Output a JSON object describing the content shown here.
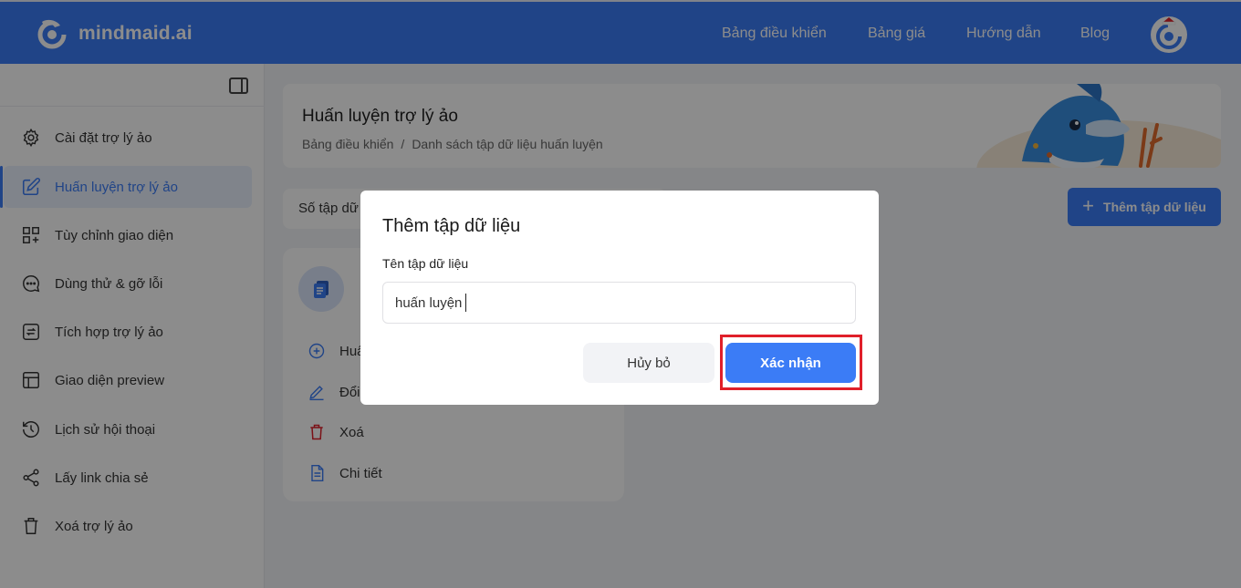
{
  "app": {
    "brand": "mindmaid.ai",
    "accent_color": "#3b7cf6"
  },
  "nav": {
    "links": [
      "Bảng điều khiển",
      "Bảng giá",
      "Hướng dẫn",
      "Blog"
    ]
  },
  "sidebar": {
    "items": [
      {
        "label": "Cài đặt trợ lý ảo",
        "icon": "gear-icon"
      },
      {
        "label": "Huấn luyện trợ lý ảo",
        "icon": "edit-icon"
      },
      {
        "label": "Tùy chỉnh giao diện",
        "icon": "grid-plus-icon"
      },
      {
        "label": "Dùng thử & gỡ lỗi",
        "icon": "chat-icon"
      },
      {
        "label": "Tích hợp trợ lý ảo",
        "icon": "sync-icon"
      },
      {
        "label": "Giao diện preview",
        "icon": "layout-icon"
      },
      {
        "label": "Lịch sử hội thoại",
        "icon": "history-icon"
      },
      {
        "label": "Lấy link chia sẻ",
        "icon": "share-icon"
      },
      {
        "label": "Xoá trợ lý ảo",
        "icon": "trash-icon"
      }
    ]
  },
  "page": {
    "title": "Huấn luyện trợ lý ảo",
    "breadcrumb": [
      "Bảng điều khiển",
      "/",
      "Danh sách tập dữ liệu huấn luyện"
    ],
    "count_label": "Số tập dữ",
    "add_button": "Thêm tập dữ liệu"
  },
  "dataset_card": {
    "menu": [
      {
        "label": "Huấ",
        "icon": "plus-circle-icon"
      },
      {
        "label": "Đổi",
        "icon": "pencil-icon"
      },
      {
        "label": "Xoá",
        "icon": "trash-icon"
      },
      {
        "label": "Chi tiết",
        "icon": "document-icon"
      }
    ]
  },
  "modal": {
    "title": "Thêm tập dữ liệu",
    "field_label": "Tên tập dữ liệu",
    "field_value": "huấn luyện",
    "cancel_label": "Hủy bỏ",
    "confirm_label": "Xác nhận",
    "highlight_color": "#e0202a"
  }
}
